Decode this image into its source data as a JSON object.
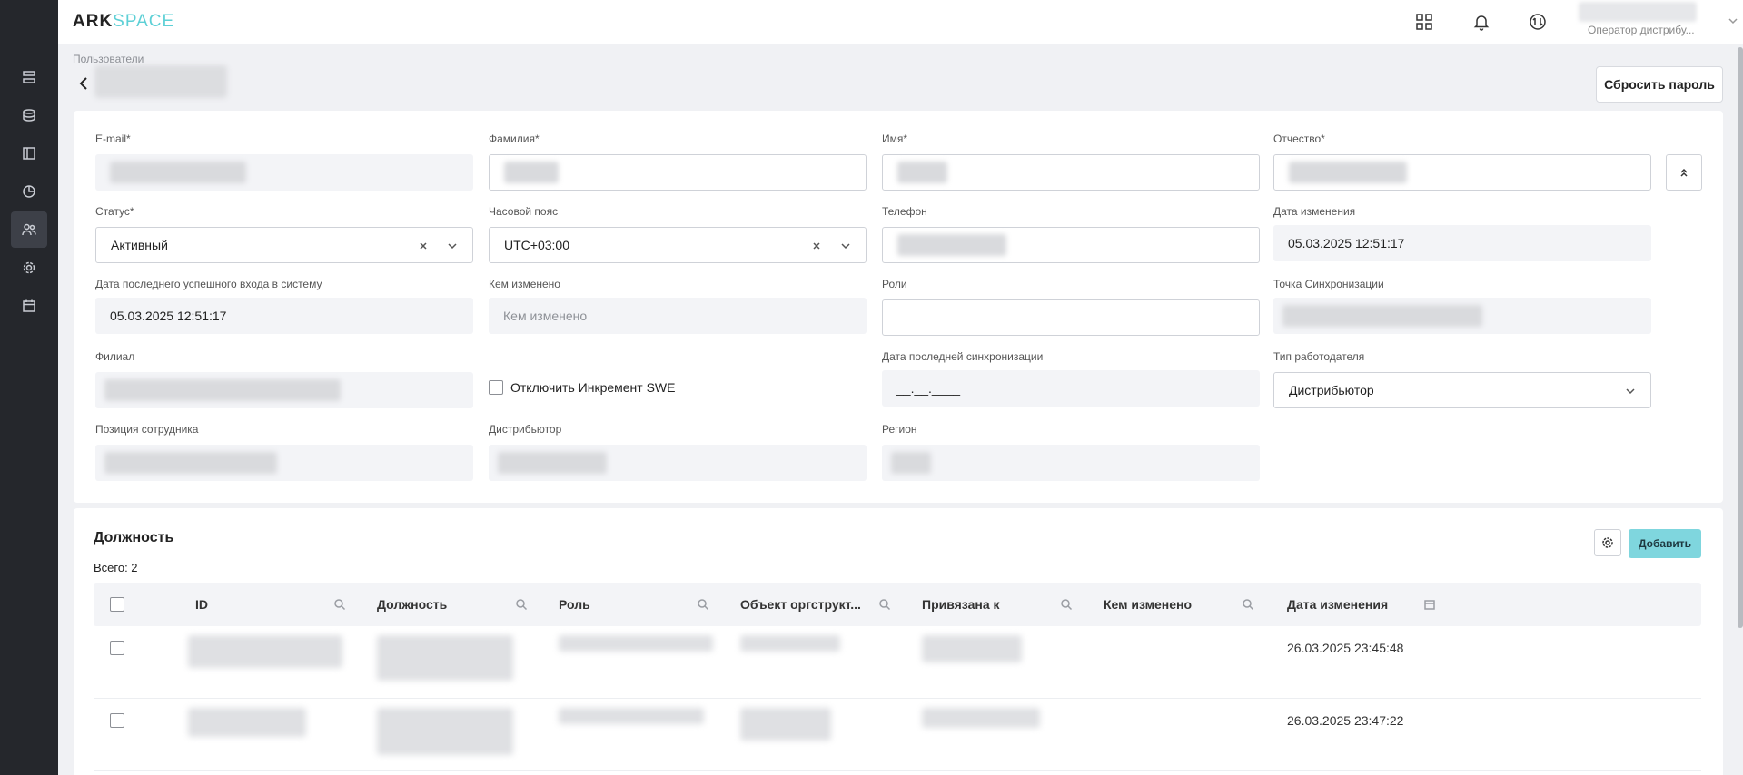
{
  "app": {
    "logo_ark": "ARK",
    "logo_space": "SPACE"
  },
  "user": {
    "role": "Оператор дистрибу..."
  },
  "page": {
    "breadcrumb": "Пользователи",
    "reset_password": "Сбросить пароль"
  },
  "form": {
    "email": {
      "label": "E-mail*"
    },
    "last_name": {
      "label": "Фамилия*"
    },
    "first_name": {
      "label": "Имя*"
    },
    "middle_name": {
      "label": "Отчество*"
    },
    "status": {
      "label": "Статус*",
      "value": "Активный"
    },
    "timezone": {
      "label": "Часовой пояс",
      "value": "UTC+03:00"
    },
    "phone": {
      "label": "Телефон"
    },
    "modified_date": {
      "label": "Дата изменения",
      "value": "05.03.2025 12:51:17"
    },
    "last_login": {
      "label": "Дата последнего успешного входа в систему",
      "value": "05.03.2025 12:51:17"
    },
    "modified_by": {
      "label": "Кем изменено",
      "placeholder": "Кем изменено"
    },
    "roles": {
      "label": "Роли"
    },
    "sync_point": {
      "label": "Точка Синхронизации"
    },
    "branch": {
      "label": "Филиал"
    },
    "disable_increment": {
      "label": "Отключить Инкремент SWE",
      "checked": false
    },
    "last_sync": {
      "label": "Дата последней синхронизации",
      "value": "__.__.____"
    },
    "employer_type": {
      "label": "Тип работодателя",
      "value": "Дистрибьютор"
    },
    "employee_position": {
      "label": "Позиция сотрудника"
    },
    "distributor": {
      "label": "Дистрибьютор"
    },
    "region": {
      "label": "Регион"
    }
  },
  "positions": {
    "title": "Должность",
    "total": "Всего: 2",
    "add_label": "Добавить",
    "columns": [
      "ID",
      "Должность",
      "Роль",
      "Объект оргструкт...",
      "Привязана к",
      "Кем изменено",
      "Дата изменения"
    ],
    "rows": [
      {
        "date": "26.03.2025 23:45:48"
      },
      {
        "date": "26.03.2025 23:47:22"
      }
    ]
  }
}
